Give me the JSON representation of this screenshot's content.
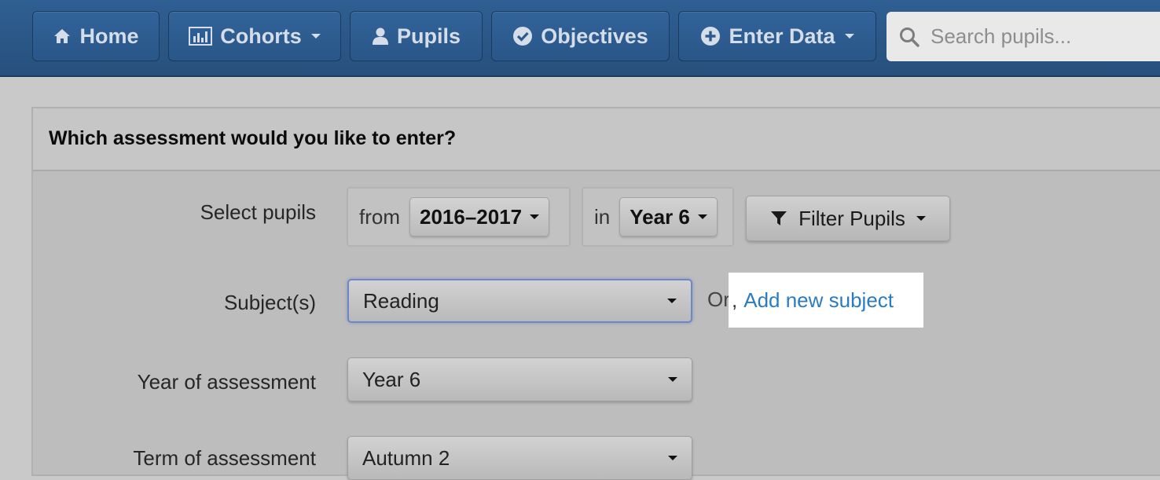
{
  "nav": {
    "items": [
      {
        "label": "Home",
        "icon": "home-icon",
        "dropdown": false
      },
      {
        "label": "Cohorts",
        "icon": "bar-chart-icon",
        "dropdown": true
      },
      {
        "label": "Pupils",
        "icon": "user-icon",
        "dropdown": false
      },
      {
        "label": "Objectives",
        "icon": "check-circle-icon",
        "dropdown": false
      },
      {
        "label": "Enter Data",
        "icon": "plus-circle-icon",
        "dropdown": true
      }
    ],
    "search": {
      "placeholder": "Search pupils..."
    }
  },
  "panel": {
    "title": "Which assessment would you like to enter?",
    "select_pupils": {
      "label": "Select pupils",
      "from_text": "from",
      "year_range": "2016–2017",
      "in_text": "in",
      "year_group": "Year 6",
      "filter_label": "Filter Pupils"
    },
    "subjects": {
      "label": "Subject(s)",
      "value": "Reading",
      "or_text": "Or",
      "comma": ",",
      "add_link": "Add new subject"
    },
    "year_of_assessment": {
      "label": "Year of assessment",
      "value": "Year 6"
    },
    "term_of_assessment": {
      "label": "Term of assessment",
      "value": "Autumn 2"
    }
  },
  "colors": {
    "navbar": "#2f5f93",
    "link": "#2a7cc2",
    "focus_border": "#6c87c4"
  }
}
